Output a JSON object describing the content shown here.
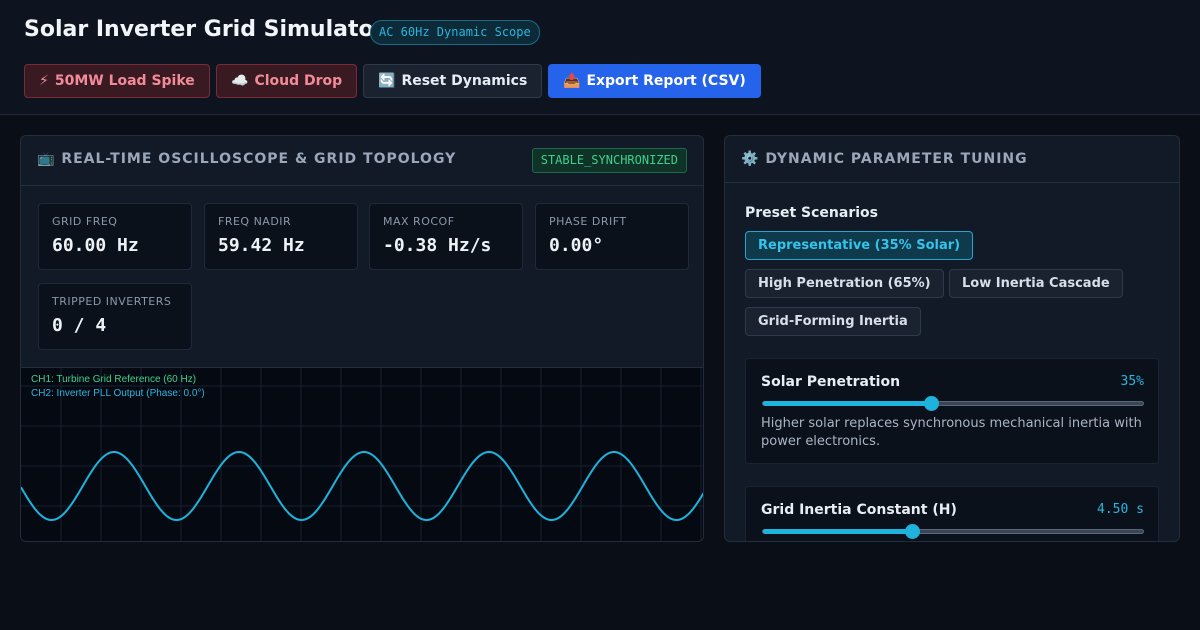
{
  "header": {
    "title": "Solar Inverter Grid Simulator",
    "badge": "AC 60Hz Dynamic Scope"
  },
  "toolbar": {
    "load_spike": {
      "icon": "⚡",
      "label": "50MW Load Spike"
    },
    "cloud_drop": {
      "icon": "☁️",
      "label": "Cloud Drop"
    },
    "reset": {
      "icon": "🔄",
      "label": "Reset Dynamics"
    },
    "export": {
      "icon": "📤",
      "label": "Export Report (CSV)"
    }
  },
  "scope_panel": {
    "icon": "📺",
    "title": "REAL-TIME OSCILLOSCOPE & GRID TOPOLOGY",
    "status": "STABLE_SYNCHRONIZED",
    "metrics": [
      {
        "label": "GRID FREQ",
        "value": "60.00 Hz"
      },
      {
        "label": "FREQ NADIR",
        "value": "59.42 Hz"
      },
      {
        "label": "MAX ROCOF",
        "value": "-0.38 Hz/s"
      },
      {
        "label": "PHASE DRIFT",
        "value": "0.00°"
      },
      {
        "label": "TRIPPED INVERTERS",
        "value": "0 / 4"
      }
    ],
    "legend": {
      "ch1": "CH1: Turbine Grid Reference (60 Hz)",
      "ch2": "CH2: Inverter PLL Output (Phase: 0.0°)"
    },
    "trace_color": "#1eb3dc"
  },
  "tuning_panel": {
    "icon": "⚙️",
    "title": "DYNAMIC PARAMETER TUNING",
    "preset_label": "Preset Scenarios",
    "presets": [
      {
        "label": "Representative (35% Solar)",
        "active": true
      },
      {
        "label": "High Penetration (65%)",
        "active": false
      },
      {
        "label": "Low Inertia Cascade",
        "active": false
      },
      {
        "label": "Grid-Forming Inertia",
        "active": false
      }
    ],
    "sliders": [
      {
        "label": "Solar Penetration",
        "value": "35%",
        "fraction": 0.44,
        "desc": "Higher solar replaces synchronous mechanical inertia with power electronics."
      },
      {
        "label": "Grid Inertia Constant (H)",
        "value": "4.50 s",
        "fraction": 0.39,
        "desc": ""
      }
    ]
  },
  "colors": {
    "accent": "#1eb3dc",
    "ok": "#3fd08f",
    "danger": "#f28b98",
    "primary": "#2563eb"
  }
}
